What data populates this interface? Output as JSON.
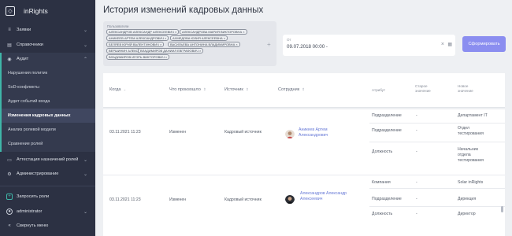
{
  "app": {
    "name": "inRights"
  },
  "sidebar": {
    "items": [
      {
        "icon": "layers-icon",
        "label": "Заявки"
      },
      {
        "icon": "book-icon",
        "label": "Справочники"
      },
      {
        "icon": "eye-icon",
        "label": "Аудит"
      }
    ],
    "audit_sub": [
      "Нарушения политик",
      "SoD-конфликты",
      "Аудит событий входа",
      "Изменения кадровых данных",
      "Анализ ролевой модели",
      "Сравнение ролей"
    ],
    "bottom_items": [
      {
        "icon": "doc-icon",
        "label": "Аттестация назначений ролей"
      },
      {
        "icon": "gear-icon",
        "label": "Администрирование"
      }
    ],
    "request_roles": "Запросить роли",
    "user": "administrator",
    "collapse": "Свернуть меню"
  },
  "page": {
    "title": "История изменений кадровых данных"
  },
  "filters": {
    "user_label": "Пользователи",
    "chips": [
      "АЛЕКСАНДРОВ АЛЕКСАНДР АЛЕКСЕЕВИЧ",
      "АЛЕКСАНДРОВА МАРИЯ ВИКТОРОВНА",
      "АНИКЕЕВ АРТЕМ АЛЕКСАНДРОВИЧ",
      "АХМЕДОВА ЮЛИЯ АЛЕКСЕЕВНА",
      "БЕЛЯЕВ ЮРИЙ ВАЛЕНТИНОВИЧ",
      "ВАСИЛЬЕВА АНТОНИНА ВЛАДИМИРОВНА",
      "ВЕРШИНИН АЛЕКСЕЙ",
      "ВЛАДИМИРОВ ДАНИИЛ ЕВГРАФОВИЧ",
      "ВЛАДИМИРОВ ИГОРЬ ВИКТОРОВИЧ"
    ],
    "date_label": "От",
    "date_value": "09.07.2018 00:00 -",
    "generate_button": "Сформировать"
  },
  "table": {
    "headers": {
      "when": "Когда",
      "what": "Что произошло",
      "source": "Источник",
      "employee": "Сотрудник",
      "attribute": "Атрибут",
      "old": "Старое значение",
      "new": "Новое значение"
    },
    "rows": [
      {
        "when": "03.11.2021 11:23",
        "what": "Изменен",
        "source": "Кадровый источник",
        "employee": "Аникеев Артем Александрович",
        "changes": [
          {
            "attr": "Подразделение",
            "old": "-",
            "new": "Департамент IT"
          },
          {
            "attr": "Подразделение",
            "old": "-",
            "new": "Отдел тестирования"
          },
          {
            "attr": "Должность",
            "old": "-",
            "new": "Начальник отдела тестирования"
          }
        ]
      },
      {
        "when": "03.11.2021 11:23",
        "what": "Изменен",
        "source": "Кадровый источник",
        "employee": "Александров Александр Алексеевич",
        "changes": [
          {
            "attr": "Компания",
            "old": "-",
            "new": "Solar inRights"
          },
          {
            "attr": "Подразделение",
            "old": "-",
            "new": "Дирекция"
          },
          {
            "attr": "Должность",
            "old": "-",
            "new": "Директор"
          }
        ]
      }
    ]
  }
}
